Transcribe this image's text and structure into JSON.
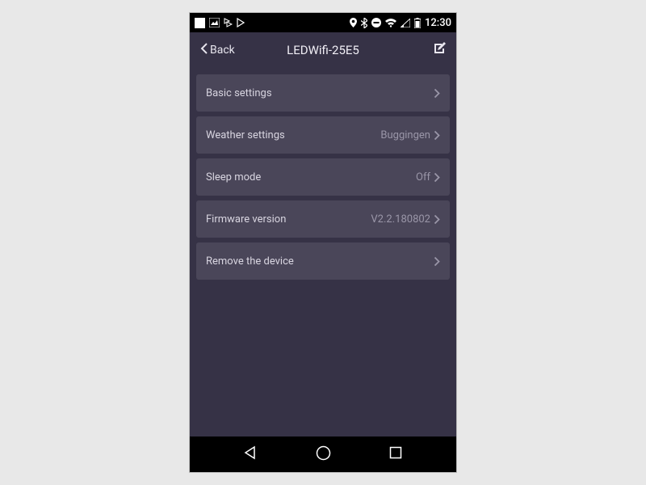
{
  "statusBar": {
    "time": "12:30"
  },
  "header": {
    "back_label": "Back",
    "title": "LEDWifi-25E5"
  },
  "settings": [
    {
      "label": "Basic settings",
      "value": ""
    },
    {
      "label": "Weather settings",
      "value": "Buggingen"
    },
    {
      "label": "Sleep mode",
      "value": "Off"
    },
    {
      "label": "Firmware version",
      "value": "V2.2.180802"
    },
    {
      "label": "Remove the device",
      "value": ""
    }
  ]
}
